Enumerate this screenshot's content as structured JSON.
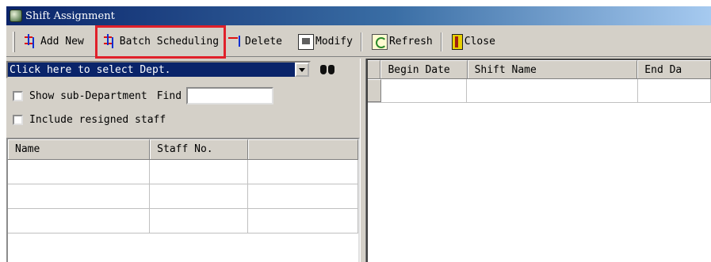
{
  "window": {
    "title": "Shift Assignment"
  },
  "toolbar": {
    "buttons": [
      {
        "label": "Add New",
        "icon": "add-icon"
      },
      {
        "label": "Batch Scheduling",
        "icon": "batch-add-icon",
        "highlighted": true
      },
      {
        "label": "Delete",
        "icon": "delete-icon"
      },
      {
        "label": "Modify",
        "icon": "modify-icon"
      },
      {
        "label": "Refresh",
        "icon": "refresh-icon"
      },
      {
        "label": "Close",
        "icon": "close-door-icon"
      }
    ]
  },
  "dept": {
    "selected": "Click here to select Dept.",
    "search_icon": "binoculars-icon"
  },
  "options": {
    "show_sub_dept": {
      "label": "Show sub-Department",
      "checked": false
    },
    "find": {
      "label": "Find",
      "value": ""
    },
    "include_resigned": {
      "label": "Include resigned staff",
      "checked": false
    }
  },
  "staff_grid": {
    "columns": [
      "Name",
      "Staff No.",
      ""
    ],
    "rows": [
      [
        "",
        "",
        ""
      ],
      [
        "",
        "",
        ""
      ],
      [
        "",
        "",
        ""
      ]
    ]
  },
  "shift_grid": {
    "columns": [
      "Begin Date",
      "Shift Name",
      "End Da"
    ],
    "rows": [
      [
        "",
        "",
        ""
      ]
    ]
  },
  "colors": {
    "highlight": "#e0202a",
    "selection": "#0a246a",
    "face": "#d4d0c8"
  }
}
